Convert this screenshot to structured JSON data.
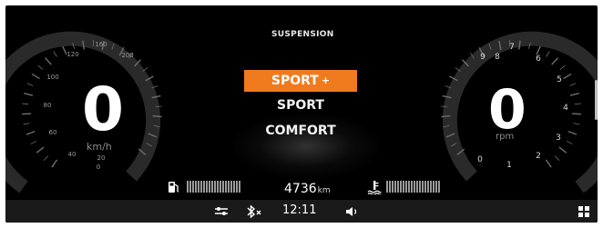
{
  "speedometer": {
    "value": "0",
    "unit": "km/h",
    "ticks": [
      "0",
      "20",
      "40",
      "60",
      "80",
      "100",
      "120",
      "160",
      "200"
    ]
  },
  "tachometer": {
    "value": "0",
    "unit": "rpm",
    "ticks": [
      "0",
      "1",
      "2",
      "3",
      "4",
      "5",
      "6",
      "7",
      "8",
      "9"
    ]
  },
  "suspension": {
    "title": "SUSPENSION",
    "modes": [
      {
        "label": "SPORT",
        "suffix": "+",
        "selected": true
      },
      {
        "label": "SPORT",
        "selected": false
      },
      {
        "label": "COMFORT",
        "selected": false
      }
    ],
    "selected_color": "#f07a1e"
  },
  "fuel": {
    "icon": "fuel-pump-icon"
  },
  "coolant": {
    "icon": "coolant-temperature-icon"
  },
  "odometer": {
    "value": "4736",
    "unit": "km"
  },
  "statusbar": {
    "clock": "12:11",
    "icons": [
      "driver-assist-icon",
      "bluetooth-off-icon",
      "volume-icon",
      "apps-grid-icon"
    ]
  }
}
